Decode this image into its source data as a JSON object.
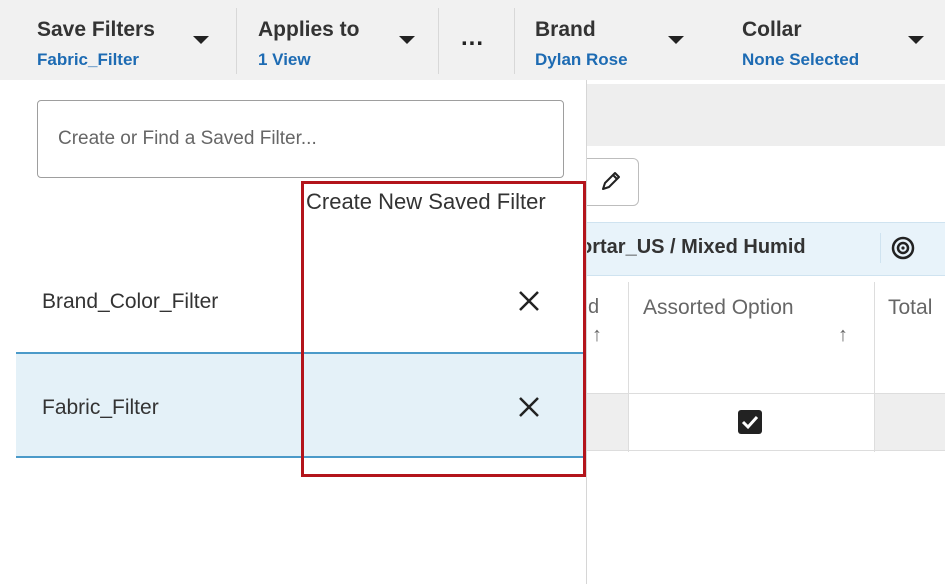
{
  "filter_bar": {
    "save_filters": {
      "label": "Save Filters",
      "value": "Fabric_Filter"
    },
    "applies_to": {
      "label": "Applies to",
      "value": "1 View"
    },
    "more": "...",
    "brand": {
      "label": "Brand",
      "value": "Dylan Rose"
    },
    "collar": {
      "label": "Collar",
      "value": "None Selected"
    }
  },
  "saved_filter_panel": {
    "search_placeholder": "Create or Find a Saved Filter...",
    "create_new_label": "Create New Saved Filter",
    "items": [
      {
        "label": "Brand_Color_Filter",
        "selected": false
      },
      {
        "label": "Fabric_Filter",
        "selected": true
      }
    ]
  },
  "background_grid": {
    "location_header": "ortar_US / Mixed Humid",
    "column_fragment": "d",
    "columns": [
      "Assorted Option",
      "Total"
    ],
    "sort_arrow": "↑",
    "assorted_checked": true
  },
  "colors": {
    "accent_blue": "#1d6bb3",
    "selected_row": "#e4f1f8",
    "highlight_red": "#b3141b"
  }
}
